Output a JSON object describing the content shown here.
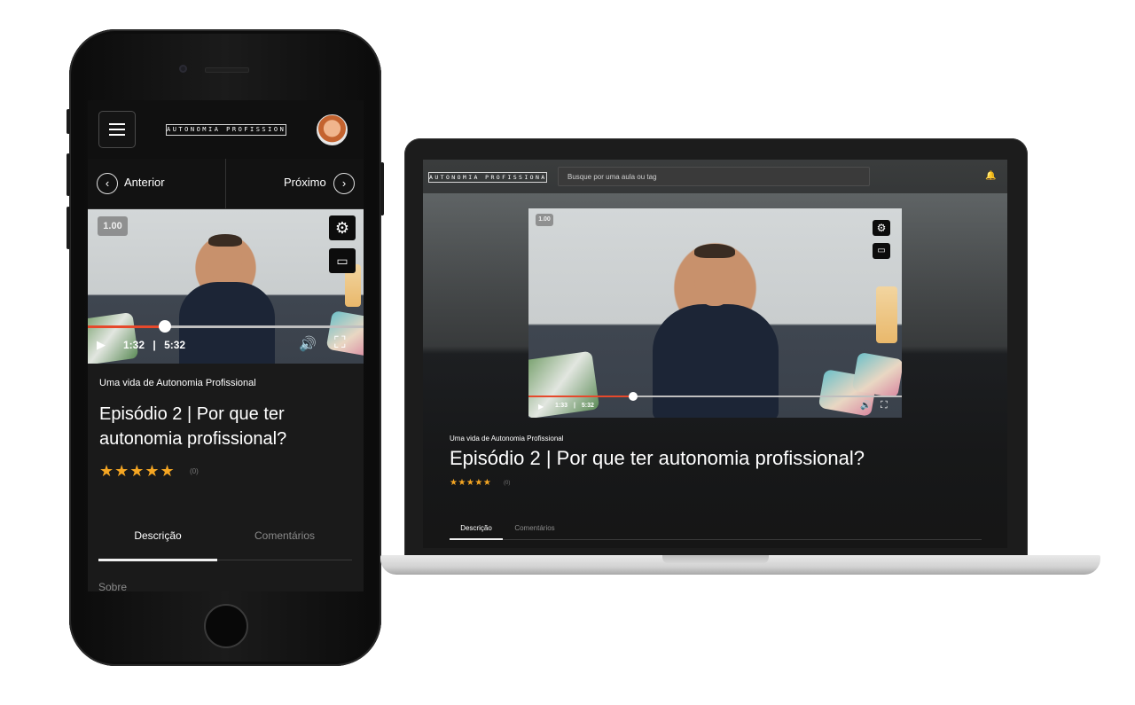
{
  "brand": "AUTONOMIA PROFISSIONAL",
  "colors": {
    "accent": "#e6492c",
    "stars": "#f5a623",
    "background": "#1a1a1a"
  },
  "mobile": {
    "nav": {
      "prev_label": "Anterior",
      "next_label": "Próximo",
      "prev_icon": "‹",
      "next_icon": "›"
    },
    "player": {
      "speed": "1.00",
      "current_time": "1:32",
      "separator": "|",
      "duration": "5:32",
      "progress": 0.28,
      "icons": {
        "settings": "⚙",
        "play": "▶",
        "volume": "🔊",
        "fullscreen": "⛶"
      }
    },
    "series": "Uma vida de Autonomia Profissional",
    "title": "Episódio 2 | Por que ter autonomia profissional?",
    "rating": {
      "stars": "★★★★★",
      "count": "(0)"
    },
    "tabs": [
      "Descrição",
      "Comentários"
    ],
    "active_tab": 0,
    "section_label": "Sobre"
  },
  "desktop": {
    "search_placeholder": "Busque por uma aula ou tag",
    "bell_icon": "🔔",
    "player": {
      "speed": "1.00",
      "current_time": "1:33",
      "separator": "|",
      "duration": "5:32",
      "progress": 0.28,
      "icons": {
        "settings": "⚙",
        "play": "▶",
        "volume": "🔊",
        "fullscreen": "⛶"
      }
    },
    "series": "Uma vida de Autonomia Profissional",
    "title": "Episódio 2 | Por que ter autonomia profissional?",
    "rating": {
      "stars": "★★★★★",
      "count": "(0)"
    },
    "tabs": [
      "Descrição",
      "Comentários"
    ],
    "active_tab": 0
  }
}
